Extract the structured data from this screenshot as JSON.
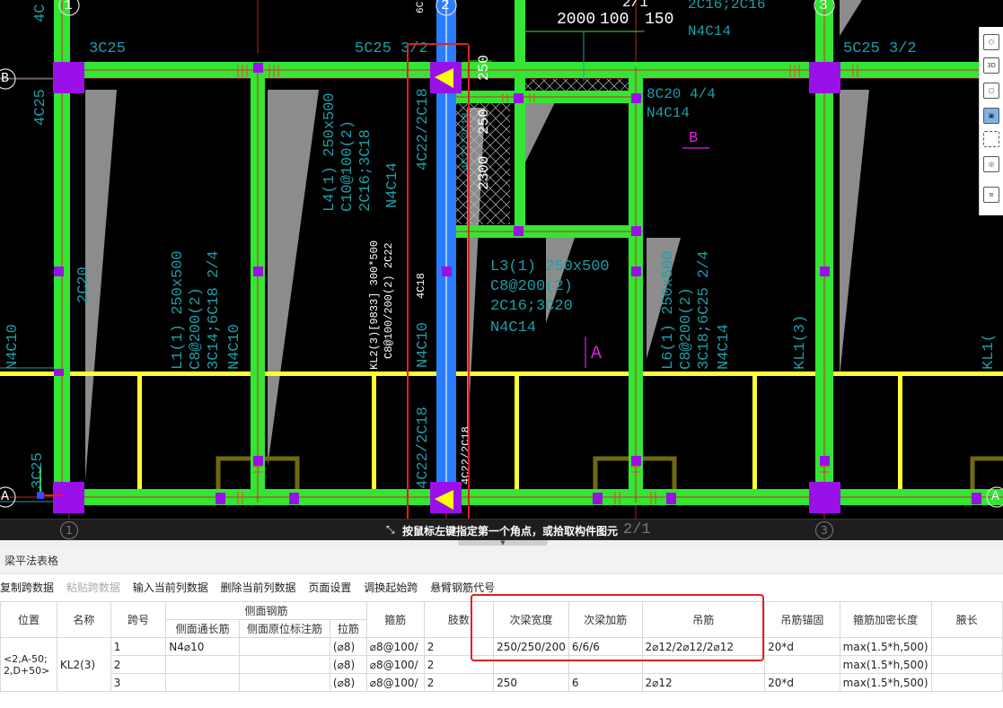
{
  "drawing": {
    "axis_top": [
      "1",
      "2",
      "2/1",
      "3"
    ],
    "axis_left": [
      "B",
      "A"
    ],
    "axis_bottom": [
      "1",
      "2/1",
      "3"
    ],
    "axis_right": [
      "A"
    ],
    "dims_top": [
      "2000",
      "100",
      "150"
    ],
    "labels": {
      "b_3c25": "3C25",
      "b_5c25_left": "5C25 3/2",
      "b_5c25_right": "5C25 3/2",
      "c_4c25": "4C25",
      "c_2c20": "2C20",
      "c_n4c10_left": "N4C10",
      "c_3c25_low": "3C25",
      "l4_name": "L4(1) 250x500",
      "l4_stir": "C10@100(2)",
      "l4_bars": "2C16;3C18",
      "l4_n": "N4C14",
      "kl2_top": "4C22/2C18",
      "kl2_bottom": "4C22/2C18",
      "kl2_mid": "4C18",
      "kl2_name": "KL2(3)[9833] 300*500",
      "kl2_stir": "C8@100/200(2) 2C22",
      "kl2_n": "N4C10",
      "dim_250a": "250",
      "dim_250b": "250",
      "dim_2300": "2300",
      "b_8c20": "8C20 4/4",
      "b_n4c14": "N4C14",
      "top_right1": "2C16;2C16",
      "top_right2": "N4C14",
      "l3_name": "L3(1) 250x500",
      "l3_stir": "C8@200(2)",
      "l3_bars": "2C16;3C20",
      "l3_n": "N4C14",
      "l1_name": "L1(1) 250x500",
      "l1_stir": "C8@200(2)",
      "l1_bars": "3C14;6C18 2/4",
      "l1_n": "N4C10",
      "kl2_bottom_lbl": "KL2(3) 300x500",
      "kl2_bottom_stir": "C8@100/200(2)",
      "l6_name": "L6(1) 250x500",
      "l6_stir": "C8@200(2)",
      "l6_bars": "3C18;6C25 2/4",
      "l6_n": "N4C14",
      "kl1": "KL1(3)",
      "kl1b": "KL1(",
      "sec_a": "A",
      "sec_b": "B",
      "kl2_side1": "4C22/2C18",
      "kl2_side2": "4C22/2C18",
      "top_clip": "4C",
      "top_clip2": "6C",
      "top_rt3": "2C16;2C16",
      "l_4c": "4C"
    }
  },
  "status": {
    "hint": "按鼠标左键指定第一个角点，或拾取构件图元"
  },
  "panel": {
    "title": "梁平法表格",
    "toolbar": [
      {
        "label": "复制跨数据",
        "enabled": true
      },
      {
        "label": "粘贴跨数据",
        "enabled": false
      },
      {
        "label": "输入当前列数据",
        "enabled": true
      },
      {
        "label": "删除当前列数据",
        "enabled": true
      },
      {
        "label": "页面设置",
        "enabled": true
      },
      {
        "label": "调换起始跨",
        "enabled": true
      },
      {
        "label": "悬臂钢筋代号",
        "enabled": true
      }
    ],
    "headers": {
      "pos": "位置",
      "name": "名称",
      "span": "跨号",
      "side": "侧面钢筋",
      "side_long": "侧面通长筋",
      "side_orig": "侧面原位标注筋",
      "tie": "拉筋",
      "stirrup": "箍筋",
      "legs": "肢数",
      "sec_width": "次梁宽度",
      "sec_add": "次梁加筋",
      "hanger": "吊筋",
      "hanger_anchor": "吊筋锚固",
      "stir_dense": "箍筋加密长度",
      "haunch": "腋长"
    },
    "position_value": "<2,A-50;\n2,D+50>",
    "name_value": "KL2(3)",
    "rows": [
      {
        "span": "1",
        "side_long": "N4⌀10",
        "side_orig": "",
        "tie": "(⌀8)",
        "stirrup": "⌀8@100/",
        "legs": "2",
        "sec_width": "250/250/200",
        "sec_add": "6/6/6",
        "hanger": "2⌀12/2⌀12/2⌀12",
        "anchor": "20*d",
        "dense": "max(1.5*h,500)",
        "haunch": ""
      },
      {
        "span": "2",
        "side_long": "",
        "side_orig": "",
        "tie": "(⌀8)",
        "stirrup": "⌀8@100/",
        "legs": "2",
        "sec_width": "",
        "sec_add": "",
        "hanger": "",
        "anchor": "",
        "dense": "max(1.5*h,500)",
        "haunch": ""
      },
      {
        "span": "3",
        "side_long": "",
        "side_orig": "",
        "tie": "(⌀8)",
        "stirrup": "⌀8@100/",
        "legs": "2",
        "sec_width": "250",
        "sec_add": "6",
        "hanger": "2⌀12",
        "anchor": "20*d",
        "dense": "max(1.5*h,500)",
        "haunch": ""
      }
    ]
  },
  "right_toolbar": [
    "3D",
    "cube",
    "box",
    "cube-blue",
    "select",
    "view-3d",
    "properties"
  ],
  "colors": {
    "beam_green": "#33e633",
    "beam_selected": "#2b7cff",
    "column": "#9a10e8",
    "text_cyan": "#1d9fa8",
    "wall_gray": "#8c8c8c",
    "yellow": "#ffff33",
    "highlight_red": "#e02020",
    "magenta": "#e020e0"
  }
}
